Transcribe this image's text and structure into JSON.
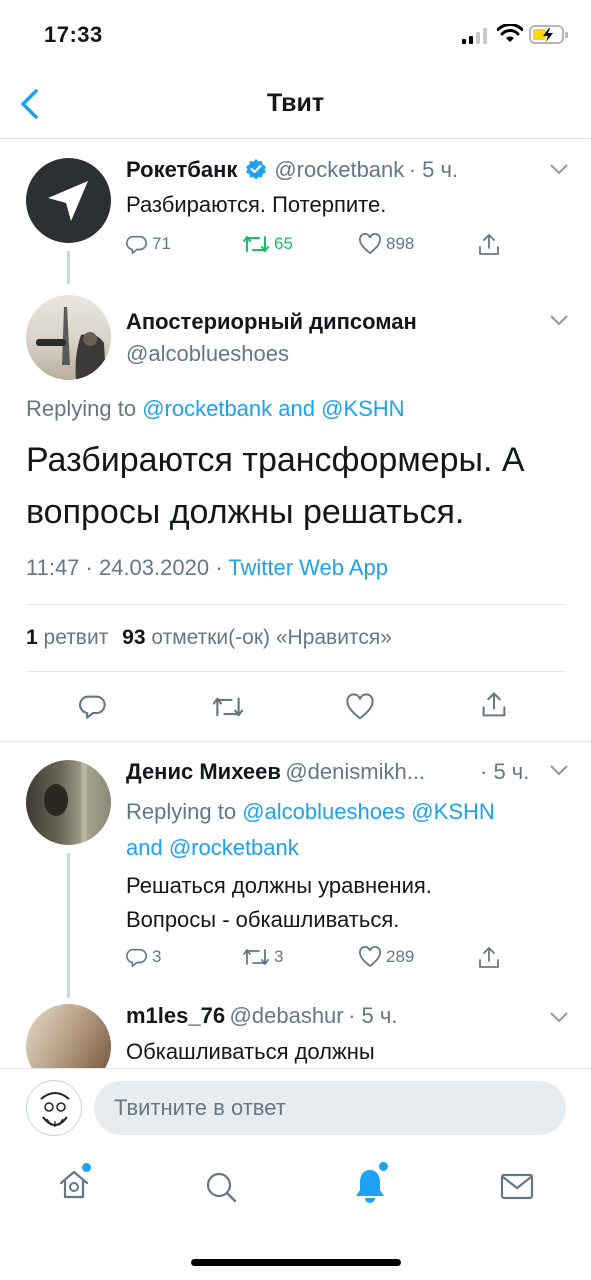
{
  "status_bar": {
    "time": "17:33"
  },
  "nav": {
    "title": "Твит"
  },
  "parent_tweet": {
    "name": "Рокетбанк",
    "handle": "@rocketbank",
    "time": "· 5 ч.",
    "text": "Разбираются. Потерпите.",
    "replies": "71",
    "retweets": "65",
    "likes": "898"
  },
  "main_tweet": {
    "name": "Апостериорный дипсоман",
    "handle": "@alcoblueshoes",
    "replying_prefix": "Replying to",
    "replying_to": "@rocketbank and @KSHN",
    "text_line1": "Разбираются трансформеры. А",
    "text_line2": "вопросы должны решаться.",
    "timestamp": "11:47 · 24.03.2020 ·",
    "source": "Twitter Web App",
    "retweet_count": "1",
    "retweet_label": "ретвит",
    "like_count": "93",
    "like_label": "отметки(-ок) «Нравится»"
  },
  "reply_1": {
    "name": "Денис Михеев",
    "handle": "@denismikh...",
    "time": "· 5 ч.",
    "replying_prefix": "Replying to",
    "replying_line1": "@alcoblueshoes @KSHN",
    "replying_line2": "and @rocketbank",
    "text_line1": "Решаться должны уравнения.",
    "text_line2": "Вопросы - обкашливаться.",
    "replies": "3",
    "retweets": "3",
    "likes": "289"
  },
  "reply_2": {
    "name": "m1les_76",
    "handle": "@debashur",
    "time": "· 5 ч.",
    "text_line1": "Обкашливаться должны"
  },
  "compose": {
    "placeholder": "Твитните в ответ"
  },
  "colors": {
    "accent": "#1da1f2",
    "retweet_green": "#17bf63",
    "secondary": "#657786"
  }
}
